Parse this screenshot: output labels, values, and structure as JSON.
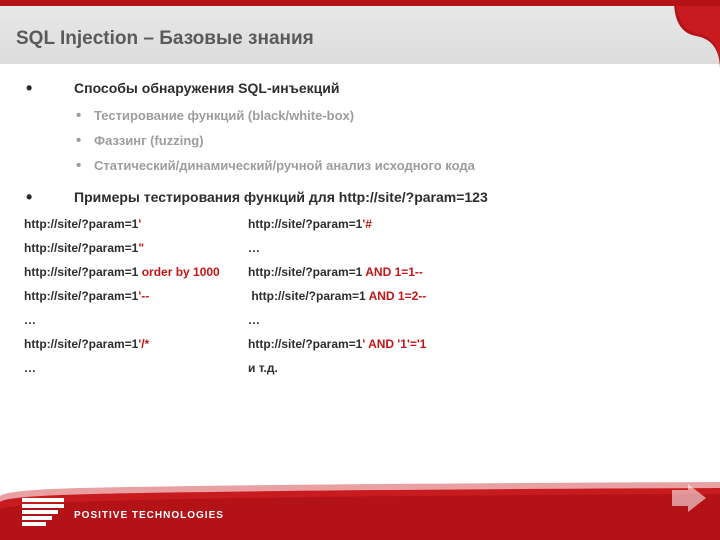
{
  "title": "SQL Injection – Базовые знания",
  "bullets": {
    "detection": "Способы обнаружения SQL-инъекций",
    "subs": [
      "Тестирование функций (black/white-box)",
      "Фаззинг (fuzzing)",
      "Статический/динамический/ручной анализ исходного кода"
    ],
    "examples_heading": "Примеры тестирования функций для http://site/?param=123"
  },
  "ex": {
    "base": "http://site/?param=1",
    "q": "'",
    "hs": "'#",
    "dq": "\"",
    "dots3": "…",
    "ob": " order by 1000",
    "a1": " AND 1=1--",
    "sd": "'--",
    "a2": " AND 1=2--",
    "el": "…",
    "sc": "'/*",
    "aa": "' AND '1'='1",
    "etc": "и т.д."
  },
  "brand": "POSITIVE TECHNOLOGIES"
}
